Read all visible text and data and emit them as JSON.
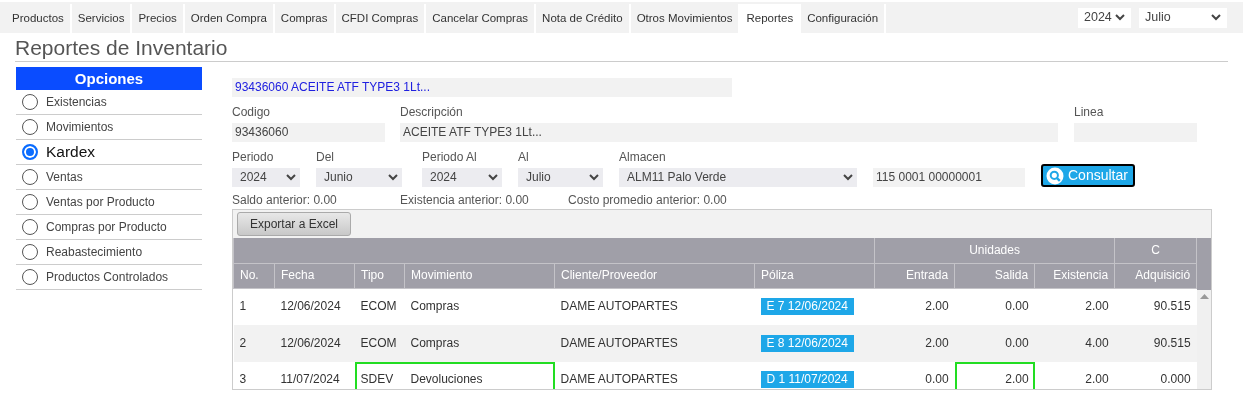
{
  "tabs": [
    {
      "label": "Productos",
      "selected": false
    },
    {
      "label": "Servicios",
      "selected": false
    },
    {
      "label": "Precios",
      "selected": false
    },
    {
      "label": "Orden Compra",
      "selected": false
    },
    {
      "label": "Compras",
      "selected": false
    },
    {
      "label": "CFDI Compras",
      "selected": false
    },
    {
      "label": "Cancelar Compras",
      "selected": false
    },
    {
      "label": "Nota de Crédito",
      "selected": false
    },
    {
      "label": "Otros Movimientos",
      "selected": false
    },
    {
      "label": "Reportes",
      "selected": true
    },
    {
      "label": "Configuración",
      "selected": false
    }
  ],
  "period_selectors": [
    {
      "value": "2024"
    },
    {
      "value": "Julio"
    }
  ],
  "page_title": "Reportes de Inventario",
  "sidebar": {
    "title": "Opciones",
    "items": [
      {
        "label": "Existencias",
        "selected": false
      },
      {
        "label": "Movimientos",
        "selected": false
      },
      {
        "label": "Kardex",
        "selected": true
      },
      {
        "label": "Ventas",
        "selected": false
      },
      {
        "label": "Ventas por Producto",
        "selected": false
      },
      {
        "label": "Compras por Producto",
        "selected": false
      },
      {
        "label": "Reabastecimiento",
        "selected": false
      },
      {
        "label": "Productos Controlados",
        "selected": false
      }
    ]
  },
  "product_search": {
    "value": "93436060 ACEITE ATF TYPE3 1Lt..."
  },
  "fields": [
    {
      "label": "Codigo",
      "value": "93436060"
    },
    {
      "label": "Descripción",
      "value": "ACEITE ATF TYPE3 1Lt..."
    },
    {
      "label": "Linea"
    }
  ],
  "filters": [
    {
      "kind": "select",
      "label": "Periodo",
      "value": "2024"
    },
    {
      "kind": "select",
      "label": "Del",
      "value": "Junio"
    },
    {
      "kind": "select",
      "label": "Periodo Al",
      "value": "2024"
    },
    {
      "kind": "select",
      "label": "Al",
      "value": "Julio"
    },
    {
      "kind": "select",
      "label": "Almacen",
      "value": "ALM11 Palo Verde"
    },
    {
      "kind": "text",
      "value": "115 0001 00000001"
    }
  ],
  "consult_button": "Consultar",
  "summary": [
    "Saldo anterior: 0.00",
    "Existencia anterior: 0.00",
    "Costo promedio anterior: 0.00"
  ],
  "export_button": "Exportar a Excel",
  "table": {
    "header_groups": [
      {
        "columns": [
          {
            "label": "No."
          },
          {
            "label": "Fecha"
          },
          {
            "label": "Tipo"
          },
          {
            "label": "Movimiento"
          },
          {
            "label": "Cliente/Proveedor"
          },
          {
            "label": "Póliza",
            "kind": "badge"
          }
        ]
      },
      {
        "label": "Unidades",
        "columns": [
          {
            "label": "Entrada",
            "kind": "number"
          },
          {
            "label": "Salida",
            "kind": "number"
          },
          {
            "label": "Existencia",
            "kind": "number"
          }
        ]
      },
      {
        "label": "C",
        "columns": [
          {
            "label": "Adquisició",
            "kind": "number"
          }
        ]
      }
    ],
    "rows": [
      {
        "cells": [
          "1",
          "12/06/2024",
          "ECOM",
          "Compras",
          "DAME AUTOPARTES",
          "E 7 12/06/2024",
          "2.00",
          "0.00",
          "2.00",
          "90.515"
        ],
        "highlight": [
          false,
          false,
          false,
          false,
          false,
          false,
          false,
          false,
          false,
          false
        ]
      },
      {
        "cells": [
          "2",
          "12/06/2024",
          "ECOM",
          "Compras",
          "DAME AUTOPARTES",
          "E 8 12/06/2024",
          "2.00",
          "0.00",
          "4.00",
          "90.515"
        ],
        "highlight": [
          false,
          false,
          false,
          false,
          false,
          false,
          false,
          false,
          false,
          false
        ]
      },
      {
        "cells": [
          "3",
          "11/07/2024",
          "SDEV",
          "Devoluciones",
          "DAME AUTOPARTES",
          "D 1 11/07/2024",
          "0.00",
          "2.00",
          "2.00",
          "0.000"
        ],
        "highlight": [
          false,
          false,
          true,
          true,
          false,
          false,
          false,
          true,
          false,
          false
        ]
      }
    ]
  }
}
